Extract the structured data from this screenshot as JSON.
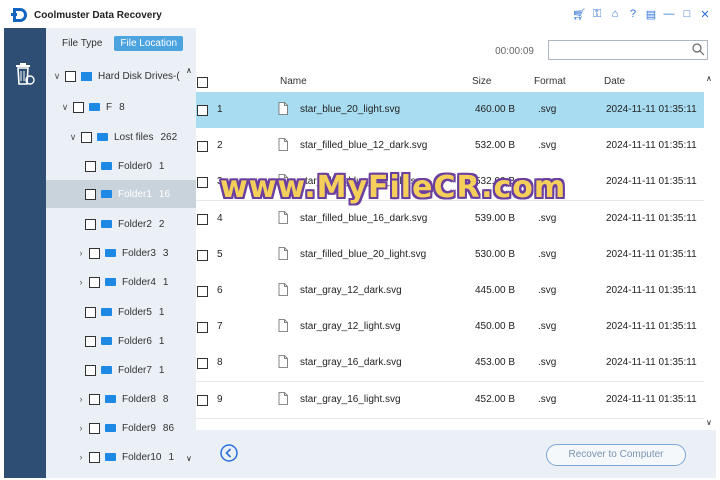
{
  "app": {
    "title": "Coolmuster Data Recovery"
  },
  "toolbar_icons": [
    "cart-icon",
    "key-icon",
    "home-icon",
    "help-icon",
    "feedback-icon",
    "minimize-icon",
    "maximize-icon",
    "close-icon"
  ],
  "left_panel": {
    "tabs": [
      "File Type",
      "File Location"
    ],
    "active_tab": "File Location",
    "tree": {
      "drive": "Hard Disk Drives-(",
      "partition": {
        "label": "F",
        "count": "8"
      },
      "lost_files": {
        "label": "Lost files",
        "count": "262"
      },
      "folders": [
        {
          "label": "Folder0",
          "count": "1"
        },
        {
          "label": "Folder1",
          "count": "16"
        },
        {
          "label": "Folder2",
          "count": "2"
        },
        {
          "label": "Folder3",
          "count": "3"
        },
        {
          "label": "Folder4",
          "count": "1"
        },
        {
          "label": "Folder5",
          "count": "1"
        },
        {
          "label": "Folder6",
          "count": "1"
        },
        {
          "label": "Folder7",
          "count": "1"
        },
        {
          "label": "Folder8",
          "count": "8"
        },
        {
          "label": "Folder9",
          "count": "86"
        },
        {
          "label": "Folder10",
          "count": "1"
        }
      ]
    }
  },
  "timer": "00:00:09",
  "search": {
    "placeholder": ""
  },
  "table": {
    "columns": [
      "Name",
      "Size",
      "Format",
      "Date"
    ],
    "rows": [
      {
        "idx": "1",
        "name": "star_blue_20_light.svg",
        "size": "460.00 B",
        "format": ".svg",
        "date": "2024-11-11 01:35:11",
        "selected": true
      },
      {
        "idx": "2",
        "name": "star_filled_blue_12_dark.svg",
        "size": "532.00 B",
        "format": ".svg",
        "date": "2024-11-11 01:35:11"
      },
      {
        "idx": "3",
        "name": "star_filled_blue_12_light.svg",
        "size": "532.00 B",
        "format": ".svg",
        "date": "2024-11-11 01:35:11"
      },
      {
        "idx": "4",
        "name": "star_filled_blue_16_dark.svg",
        "size": "539.00 B",
        "format": ".svg",
        "date": "2024-11-11 01:35:11"
      },
      {
        "idx": "5",
        "name": "star_filled_blue_20_light.svg",
        "size": "530.00 B",
        "format": ".svg",
        "date": "2024-11-11 01:35:11"
      },
      {
        "idx": "6",
        "name": "star_gray_12_dark.svg",
        "size": "445.00 B",
        "format": ".svg",
        "date": "2024-11-11 01:35:11"
      },
      {
        "idx": "7",
        "name": "star_gray_12_light.svg",
        "size": "450.00 B",
        "format": ".svg",
        "date": "2024-11-11 01:35:11"
      },
      {
        "idx": "8",
        "name": "star_gray_16_dark.svg",
        "size": "453.00 B",
        "format": ".svg",
        "date": "2024-11-11 01:35:11"
      },
      {
        "idx": "9",
        "name": "star_gray_16_light.svg",
        "size": "452.00 B",
        "format": ".svg",
        "date": "2024-11-11 01:35:11"
      }
    ]
  },
  "footer": {
    "recover_label": "Recover to Computer"
  },
  "watermark": "www.MyFileCR.com",
  "colors": {
    "accent": "#4ba3e0",
    "rail": "#2f4e73",
    "selected_row": "#a8dcf0",
    "folder": "#1e88e5"
  }
}
